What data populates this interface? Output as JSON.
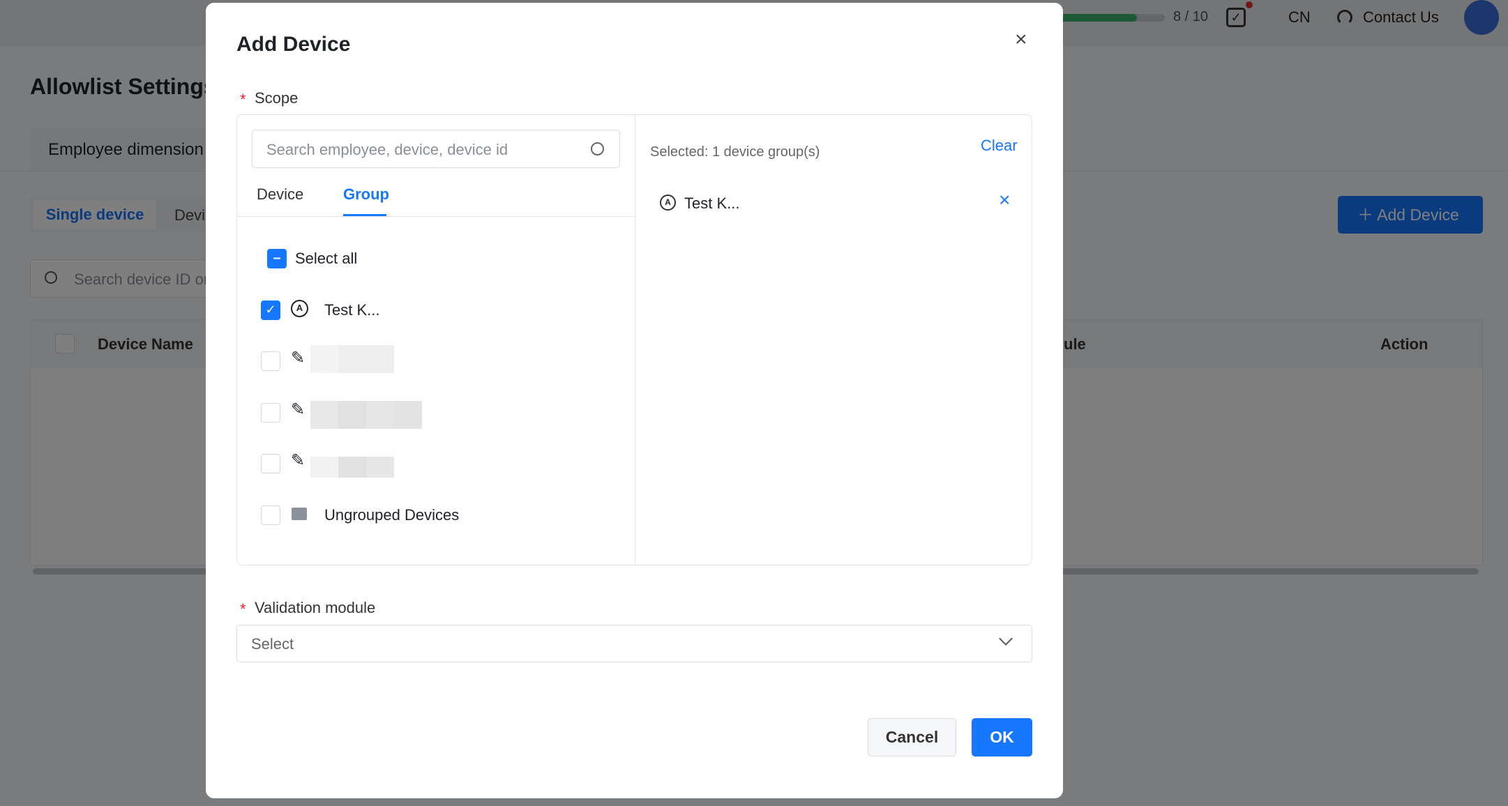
{
  "topbar": {
    "progress_text": "8 / 10",
    "progress_fraction": 0.8,
    "lang": "CN",
    "contact": "Contact Us",
    "accent": "#1677ff"
  },
  "page": {
    "title": "Allowlist Settings",
    "tab": "Employee dimension",
    "seg_active": "Single device",
    "seg_other": "Devi",
    "add_button": "Add Device",
    "search_placeholder": "Search device ID or",
    "table": {
      "columns": [
        "Device Name",
        "ule",
        "Action"
      ]
    }
  },
  "modal": {
    "title": "Add Device",
    "scope_label": "Scope",
    "search_placeholder": "Search employee, device, device id",
    "tabs": [
      "Device",
      "Group"
    ],
    "active_tab": "Group",
    "select_all": "Select all",
    "items": [
      {
        "label": "Test K...",
        "checked": true,
        "icon": "group-auto-icon"
      },
      {
        "label": "",
        "checked": false,
        "icon": "pencil-icon"
      },
      {
        "label": "",
        "checked": false,
        "icon": "pencil-icon"
      },
      {
        "label": "",
        "checked": false,
        "icon": "pencil-icon"
      },
      {
        "label": "Ungrouped Devices",
        "checked": false,
        "icon": "folder-icon"
      }
    ],
    "selected_summary": "Selected: 1 device group(s)",
    "clear": "Clear",
    "selected_items": [
      {
        "label": "Test K..."
      }
    ],
    "validation_label": "Validation module",
    "validation_placeholder": "Select",
    "cancel": "Cancel",
    "ok": "OK"
  }
}
